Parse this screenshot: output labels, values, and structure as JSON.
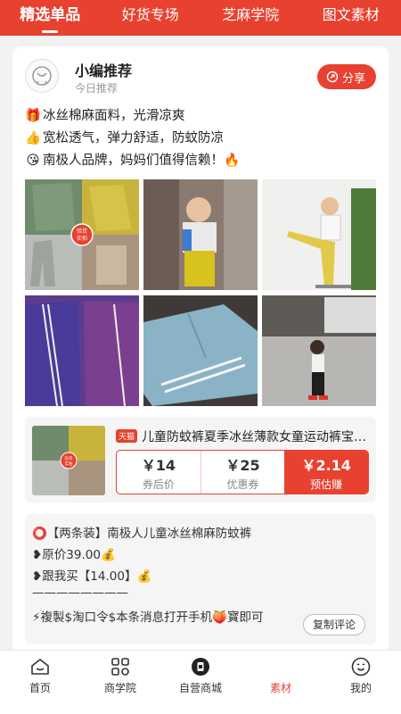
{
  "top_tabs": [
    {
      "label": "精选单品",
      "active": true
    },
    {
      "label": "好货专场",
      "active": false
    },
    {
      "label": "芝麻学院",
      "active": false
    },
    {
      "label": "图文素材",
      "active": false
    }
  ],
  "post": {
    "author": "小编推荐",
    "subtitle": "今日推荐",
    "share_label": "分享",
    "description": [
      {
        "icon": "gift-icon",
        "emoji": "🎁",
        "text": "冰丝棉麻面料，光滑凉爽"
      },
      {
        "icon": "thumbs-up-icon",
        "emoji": "👍",
        "text": "宽松透气，弹力舒适，防蚊防凉"
      },
      {
        "icon": "kiss-face-icon",
        "emoji": "😘",
        "text": "南极人品牌，妈妈们值得信赖！🔥"
      }
    ],
    "grid_badge": "验货实拍"
  },
  "product": {
    "platform_badge": "天猫",
    "title": "儿童防蚊裤夏季冰丝薄款女童运动裤宝宝...",
    "coupon_price": "￥14",
    "coupon_price_label": "券后价",
    "coupon_value": "￥25",
    "coupon_value_label": "优惠券",
    "earn": "￥2.14",
    "earn_label": "预估赚",
    "image_badge": "验货实拍"
  },
  "copy_text": {
    "lines": [
      "⭕【两条装】南极人儿童冰丝棉麻防蚊裤",
      "❥原价39.00💰",
      "❥跟我买【14.00】💰",
      "————————",
      "⚡複製$淘口令$本条消息打开手机🍑寳即可"
    ],
    "button_label": "复制评论"
  },
  "bottom_nav": [
    {
      "label": "首页",
      "icon": "home-icon",
      "active": false
    },
    {
      "label": "商学院",
      "icon": "apps-grid-icon",
      "active": false
    },
    {
      "label": "自营商城",
      "icon": "store-icon",
      "active": false
    },
    {
      "label": "素材",
      "icon": "material-icon",
      "active": true
    },
    {
      "label": "我的",
      "icon": "profile-face-icon",
      "active": false
    }
  ],
  "colors": {
    "brand": "#e8412f",
    "page_bg": "#f2f2f2"
  }
}
